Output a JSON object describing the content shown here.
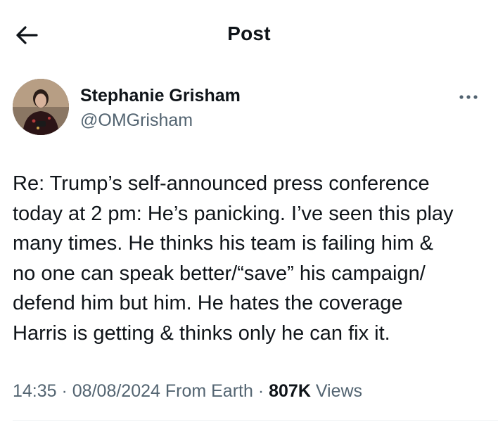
{
  "header": {
    "back_icon": "arrow-left-icon",
    "title": "Post"
  },
  "author": {
    "name": "Stephanie Grisham",
    "handle": "@OMGrisham",
    "more_icon": "ellipsis-icon"
  },
  "post": {
    "text": "Re: Trump’s self-announced press conference\ntoday at 2 pm: He’s panicking. I’ve seen this play\nmany times. He thinks his team is failing him &\nno one can speak better/“save” his campaign/\ndefend him but him. He hates the coverage\nHarris is getting & thinks only he can fix it."
  },
  "meta": {
    "time": "14:35",
    "sep1": " · ",
    "date": "08/08/2024",
    "source": " From Earth",
    "sep2": " · ",
    "views_count": "807K",
    "views_label": " Views"
  },
  "colors": {
    "text_primary": "#0f1419",
    "text_secondary": "#536471",
    "divider": "#eff3f4"
  }
}
